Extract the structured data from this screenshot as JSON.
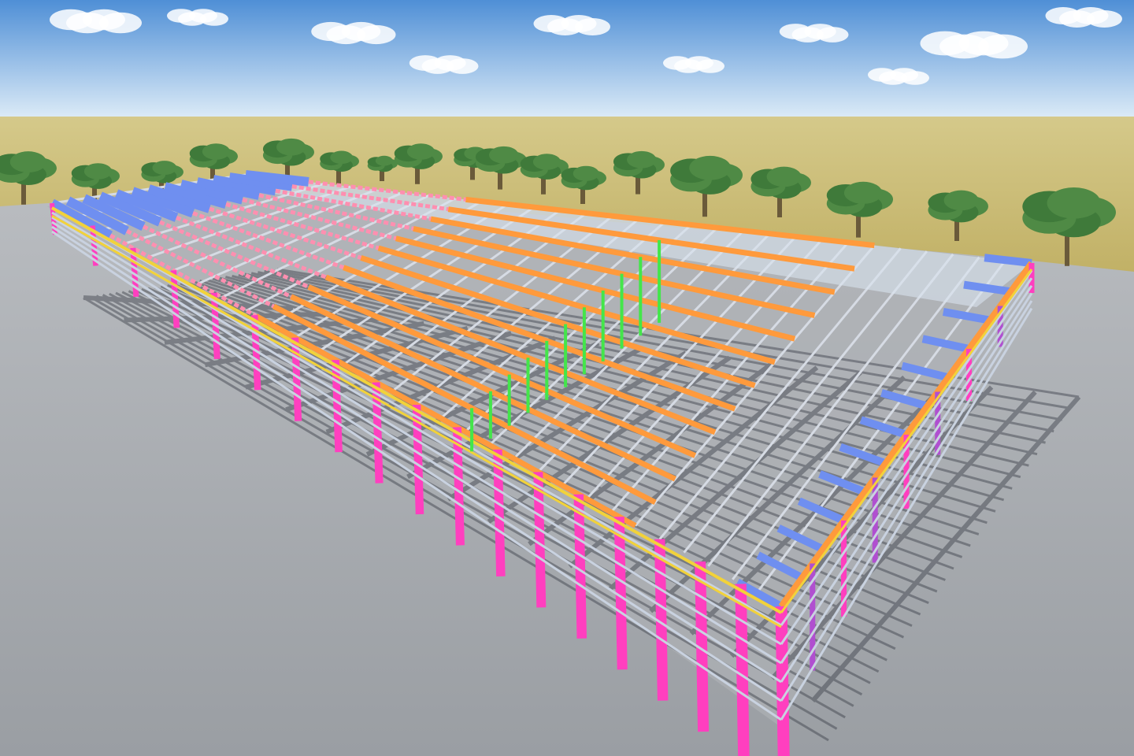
{
  "scene": {
    "subject": "steel-frame-warehouse-structure",
    "colors": {
      "sky_top": "#4f8fd6",
      "sky_bottom": "#dcebf7",
      "field": "#c9b870",
      "ground": "#a7abaf",
      "column": "#ff3fbf",
      "rafter": "#6f8ff0",
      "girt": "#c9d2e0",
      "purlin": "#d6dbe4",
      "ridge_truss": "#ff9a3c",
      "haunch_truss": "#ff8fb0",
      "eave_truss": "#f2d23a",
      "interior_column": "#43e64a",
      "tree_canopy": "#3f7a3a",
      "tree_trunk": "#6a5a3a",
      "shadow": "#3a3e48"
    }
  }
}
